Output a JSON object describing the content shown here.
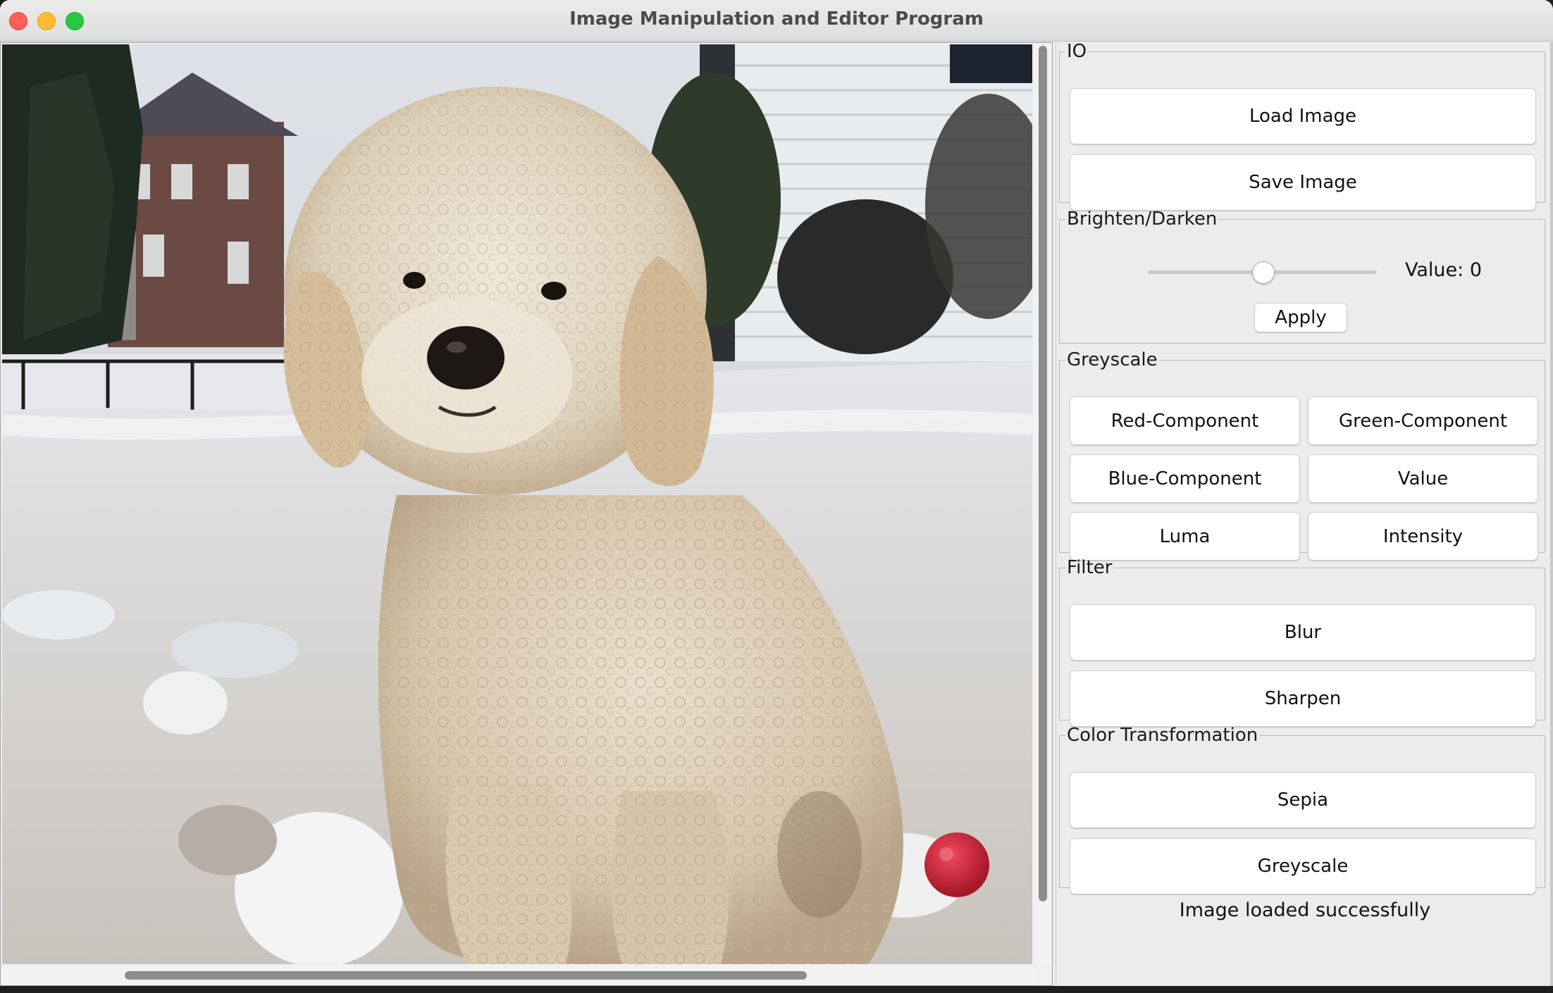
{
  "window": {
    "title": "Image Manipulation and Editor Program"
  },
  "image": {
    "alt": "Photo of a cream-colored curly poodle dog sitting in snow next to a red ball"
  },
  "panel": {
    "io": {
      "legend": "IO",
      "load": "Load Image",
      "save": "Save Image"
    },
    "brighten": {
      "legend": "Brighten/Darken",
      "value_prefix": "Value: ",
      "value": "0",
      "slider_fraction": 0.5,
      "apply": "Apply"
    },
    "greyscale": {
      "legend": "Greyscale",
      "red": "Red-Component",
      "green": "Green-Component",
      "blue": "Blue-Component",
      "value": "Value",
      "luma": "Luma",
      "intensity": "Intensity"
    },
    "filter": {
      "legend": "Filter",
      "blur": "Blur",
      "sharpen": "Sharpen"
    },
    "color": {
      "legend": "Color Transformation",
      "sepia": "Sepia",
      "greyscale": "Greyscale"
    }
  },
  "status": "Image loaded successfully",
  "colors": {
    "close": "#fe5f57",
    "minimize": "#febc2e",
    "maximize": "#28c840",
    "ball": "#d8243c"
  }
}
